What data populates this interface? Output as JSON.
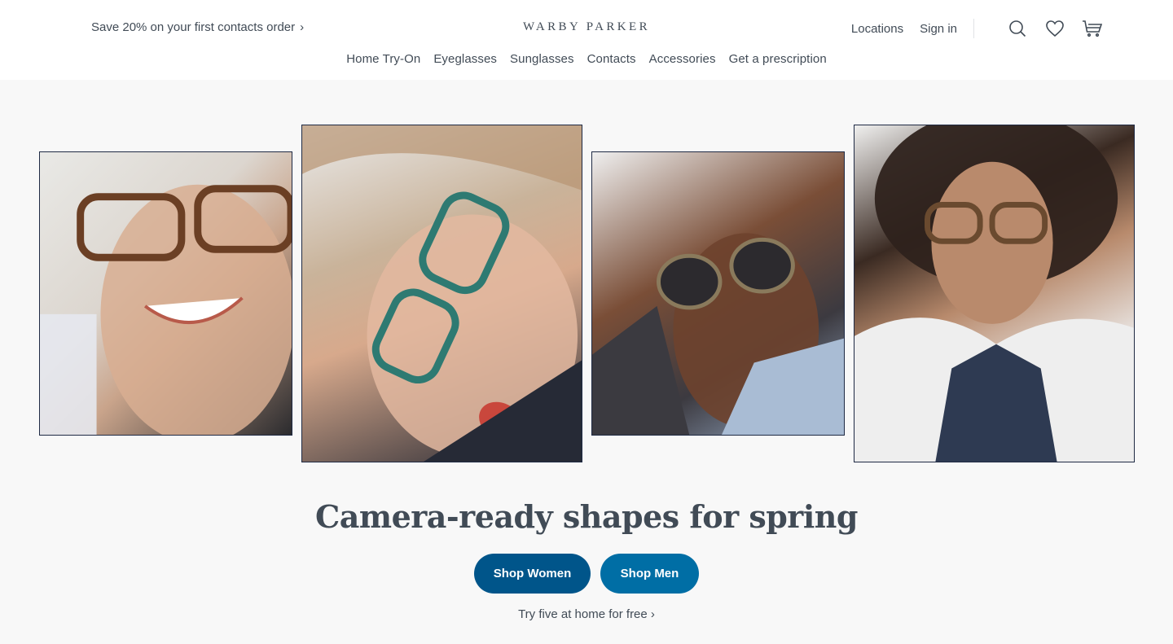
{
  "header": {
    "promo": "Save 20% on your first contacts order",
    "promo_chevron": "›",
    "logo": "WARBY PARKER",
    "locations": "Locations",
    "sign_in": "Sign in",
    "icons": [
      "search-icon",
      "heart-icon",
      "cart-icon"
    ]
  },
  "nav": {
    "items": [
      "Home Try-On",
      "Eyeglasses",
      "Sunglasses",
      "Contacts",
      "Accessories",
      "Get a prescription"
    ]
  },
  "hero": {
    "images": [
      "man-in-tortoise-glasses",
      "woman-in-green-glasses",
      "man-in-tortoise-sunglasses",
      "woman-in-tortoise-glasses"
    ],
    "headline": "Camera-ready shapes for spring",
    "shop_women": "Shop Women",
    "shop_men": "Shop Men",
    "try_at_home": "Try five at home for free",
    "try_chevron": "›"
  },
  "colors": {
    "text": "#414b56",
    "primary_button": "#00558a",
    "secondary_button": "#006ea5",
    "frame_border": "#1f2a44",
    "page_background": "#f8f8f8"
  }
}
